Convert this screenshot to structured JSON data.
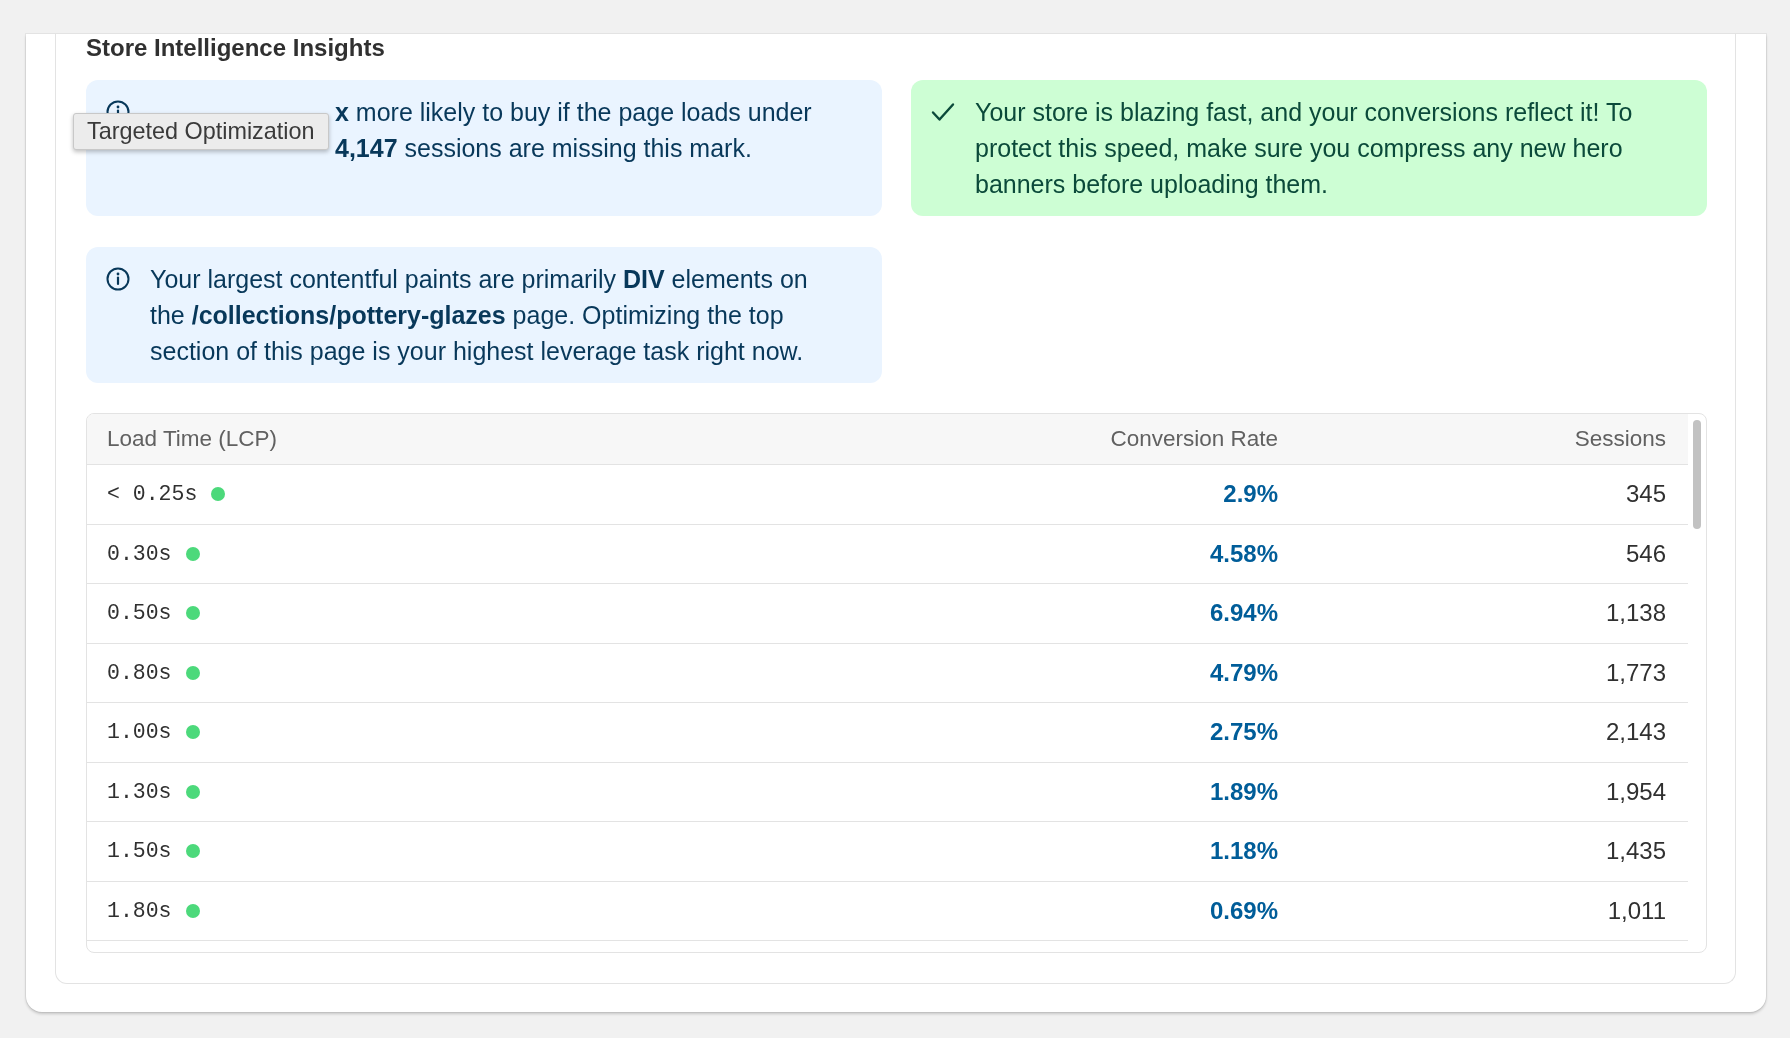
{
  "section": {
    "title": "Store Intelligence Insights"
  },
  "insights": [
    {
      "kind": "info",
      "lines": [
        "**x** more likely to buy if the page loads under",
        "**4,147** sessions are missing this mark."
      ]
    },
    {
      "kind": "success",
      "text": "Your store is blazing fast, and your conversions reflect it! To protect this speed, make sure you compress any new hero banners before uploading them."
    },
    {
      "kind": "info",
      "text": "Your largest contentful paints are primarily **DIV** elements on the **/collections/pottery-glazes** page. Optimizing the top section of this page is your highest leverage task right now."
    }
  ],
  "tooltip": {
    "text": "Targeted Optimization"
  },
  "table": {
    "columns": [
      "Load Time (LCP)",
      "Conversion Rate",
      "Sessions"
    ],
    "rows": [
      {
        "load_time": "< 0.25s",
        "color": "#4cd97b",
        "conversion_rate": "2.9%",
        "sessions": "345"
      },
      {
        "load_time": "0.30s",
        "color": "#4cd97b",
        "conversion_rate": "4.58%",
        "sessions": "546"
      },
      {
        "load_time": "0.50s",
        "color": "#4cd97b",
        "conversion_rate": "6.94%",
        "sessions": "1,138"
      },
      {
        "load_time": "0.80s",
        "color": "#4cd97b",
        "conversion_rate": "4.79%",
        "sessions": "1,773"
      },
      {
        "load_time": "1.00s",
        "color": "#4cd97b",
        "conversion_rate": "2.75%",
        "sessions": "2,143"
      },
      {
        "load_time": "1.30s",
        "color": "#4cd97b",
        "conversion_rate": "1.89%",
        "sessions": "1,954"
      },
      {
        "load_time": "1.50s",
        "color": "#4cd97b",
        "conversion_rate": "1.18%",
        "sessions": "1,435"
      },
      {
        "load_time": "1.80s",
        "color": "#4cd97b",
        "conversion_rate": "0.69%",
        "sessions": "1,011"
      }
    ]
  }
}
